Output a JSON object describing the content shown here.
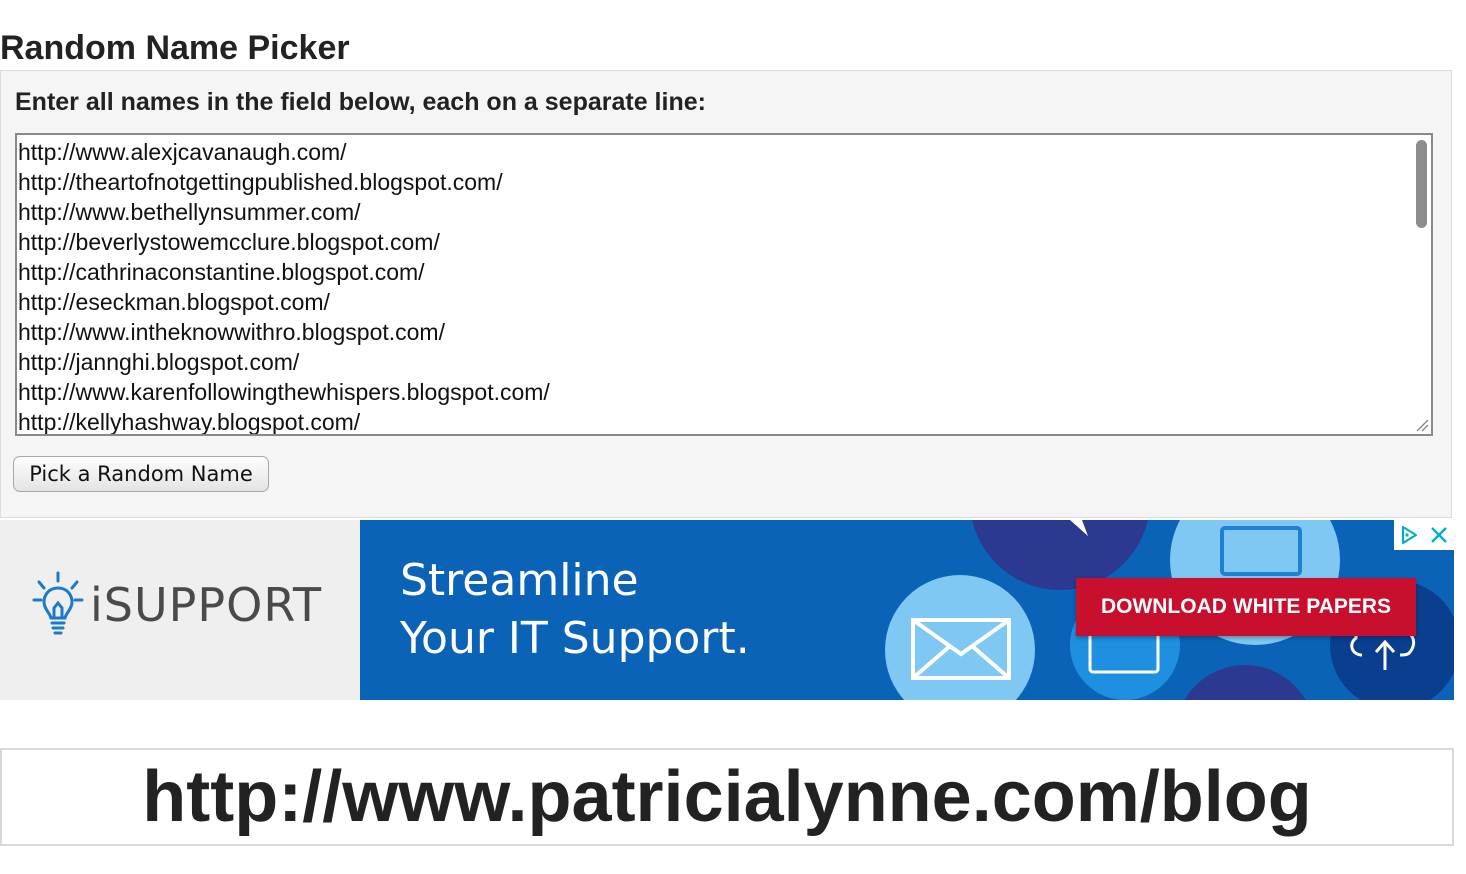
{
  "page": {
    "title": "Random Name Picker"
  },
  "picker": {
    "instruction": "Enter all names in the field below, each on a separate line:",
    "names": [
      "http://www.alexjcavanaugh.com/",
      "http://theartofnotgettingpublished.blogspot.com/",
      "http://www.bethellynsummer.com/",
      "http://beverlystowemcclure.blogspot.com/",
      "http://cathrinaconstantine.blogspot.com/",
      "http://eseckman.blogspot.com/",
      "http://www.intheknowwithro.blogspot.com/",
      "http://jannghi.blogspot.com/",
      "http://www.karenfollowingthewhispers.blogspot.com/",
      "http://kellyhashway.blogspot.com/"
    ],
    "button_label": "Pick a Random Name"
  },
  "ad": {
    "brand": "iSUPPORT",
    "headline_line1": "Streamline",
    "headline_line2": "Your IT Support.",
    "cta": "DOWNLOAD WHITE PAPERS",
    "background_color": "#0b63b8",
    "cta_color": "#c8102e",
    "adchoices_icon": "adchoices-icon",
    "close_icon": "close-icon"
  },
  "result": {
    "text": "http://www.patricialynne.com/blog"
  }
}
